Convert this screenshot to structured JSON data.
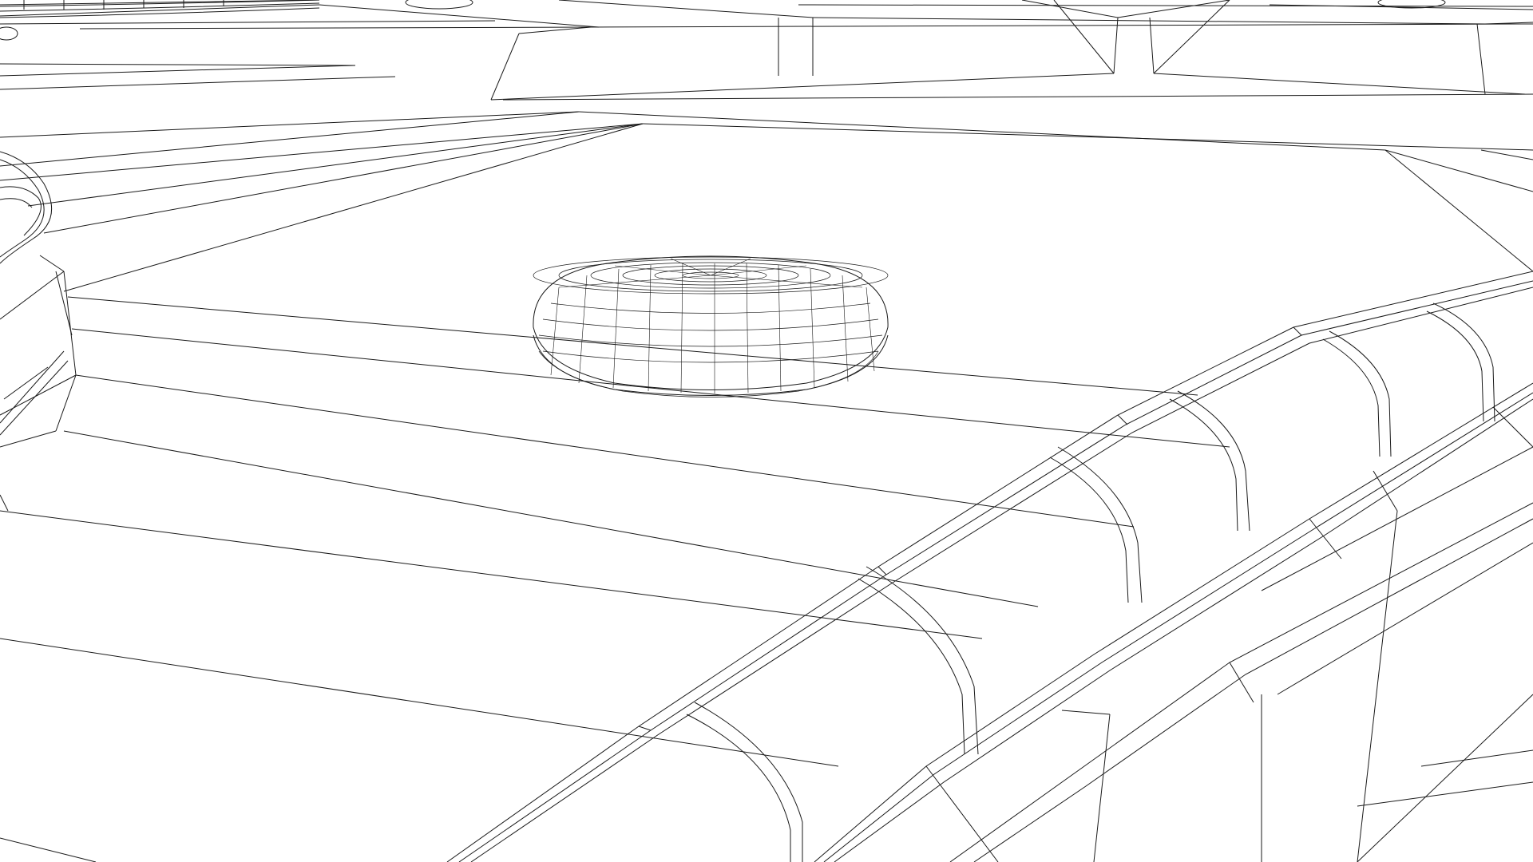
{
  "scene": {
    "description_visible_text": [],
    "colors": {
      "background": "#ffffff",
      "stroke": "#1a1a1a"
    },
    "render_style": "wireframe-line-drawing"
  }
}
